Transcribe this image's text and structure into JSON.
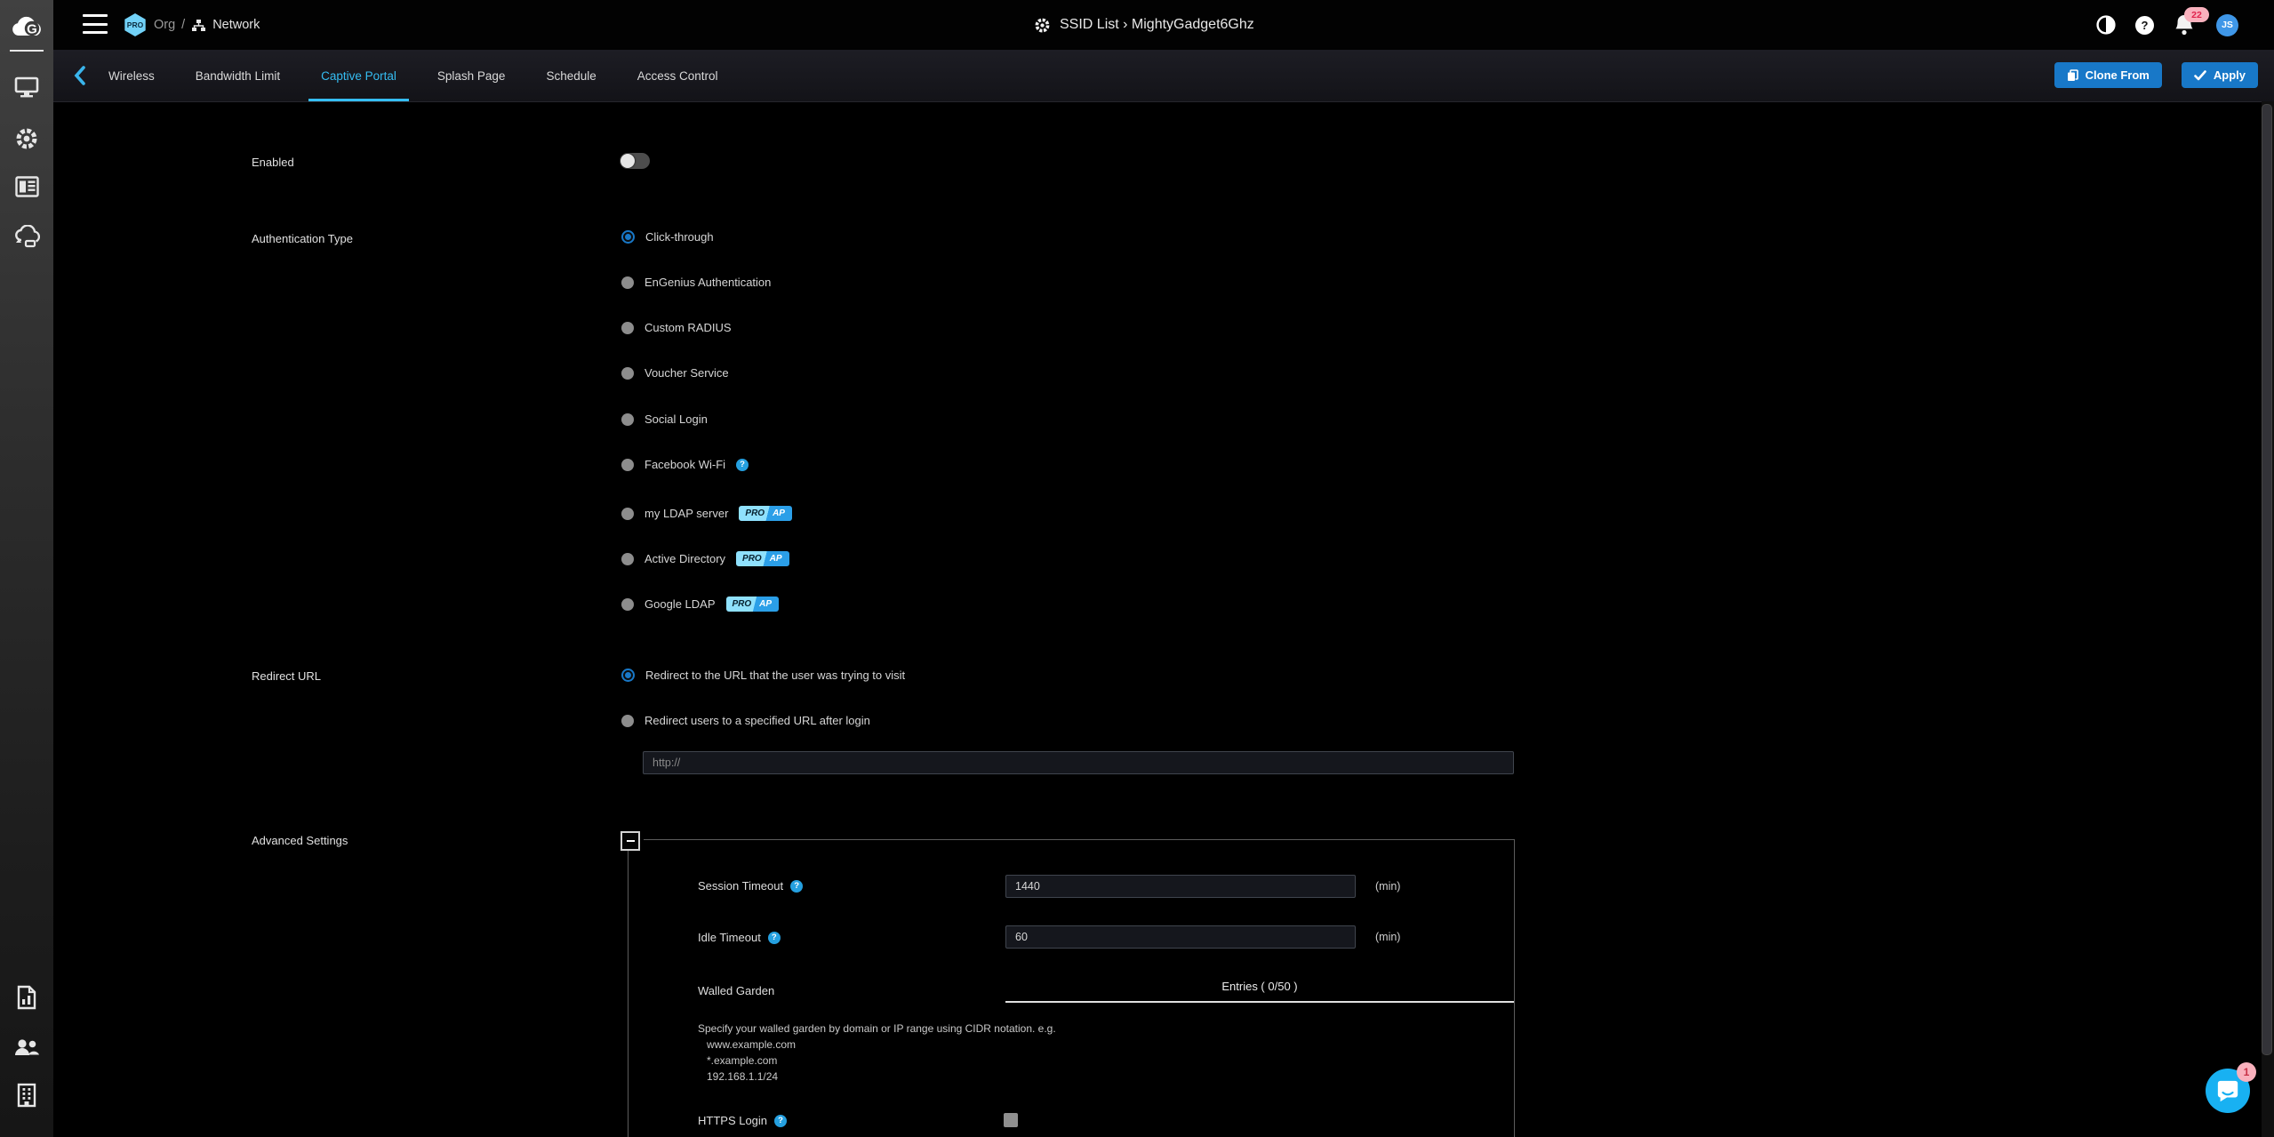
{
  "topbar": {
    "breadcrumb": {
      "org": "Org",
      "separator": "/",
      "network": "Network"
    },
    "pro_badge": "PRO",
    "title": "SSID List › MightyGadget6Ghz",
    "notification_count": "22",
    "avatar_initials": "JS"
  },
  "tabs": {
    "items": [
      "Wireless",
      "Bandwidth Limit",
      "Captive Portal",
      "Splash Page",
      "Schedule",
      "Access Control"
    ],
    "active": "Captive Portal",
    "clone_label": "Clone From",
    "apply_label": "Apply"
  },
  "form": {
    "enabled_label": "Enabled",
    "auth": {
      "label": "Authentication Type",
      "options": [
        {
          "label": "Click-through"
        },
        {
          "label": "EnGenius Authentication"
        },
        {
          "label": "Custom RADIUS"
        },
        {
          "label": "Voucher Service"
        },
        {
          "label": "Social Login"
        },
        {
          "label": "Facebook Wi-Fi"
        },
        {
          "label": "my LDAP server"
        },
        {
          "label": "Active Directory"
        },
        {
          "label": "Google LDAP"
        }
      ],
      "selected": "Click-through"
    },
    "redirect": {
      "label": "Redirect URL",
      "option1": "Redirect to the URL that the user was trying to visit",
      "option2": "Redirect users to a specified URL after login",
      "selected": "Redirect to the URL that the user was trying to visit",
      "url_placeholder": "http://"
    },
    "advanced": {
      "label": "Advanced Settings",
      "session_timeout": {
        "label": "Session Timeout",
        "value": "1440",
        "unit": "(min)"
      },
      "idle_timeout": {
        "label": "Idle Timeout",
        "value": "60",
        "unit": "(min)"
      },
      "walled_garden": {
        "label": "Walled Garden",
        "entries_header": "Entries ( 0/50 )",
        "hint": "Specify your walled garden by domain or IP range using CIDR notation. e.g.",
        "examples": [
          "www.example.com",
          "*.example.com",
          "192.168.1.1/24"
        ]
      },
      "https_login_label": "HTTPS Login"
    }
  },
  "badges": {
    "pro": "PRO",
    "ap": "AP"
  },
  "icons": {
    "help_glyph": "?"
  },
  "chat": {
    "badge": "1"
  },
  "colors": {
    "accent": "#35bdf2",
    "primary-blue": "#1878c8",
    "help-blue": "#25a0e0",
    "pro-badge-bg": "#72d2f8",
    "proap-light": "#8fe1fd",
    "proap-dark": "#2b9fe8",
    "badge-pink": "#f9b1bd",
    "badge-red": "#e0244d",
    "avatar-blue": "#3f97e8",
    "chat-cyan": "#18b1f2"
  }
}
